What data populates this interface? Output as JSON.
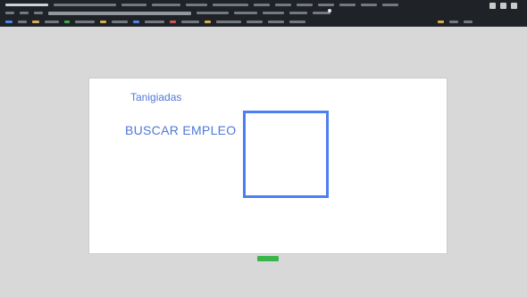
{
  "browser": {
    "window_controls": [
      "minimize",
      "maximize",
      "close"
    ]
  },
  "page": {
    "caption": "",
    "brand": "Tanigiadas",
    "headline": "BUSCAR EMPLEO",
    "side_links": [
      "",
      "",
      ""
    ],
    "cta_label": ""
  },
  "colors": {
    "page_bg": "#d8d8d8",
    "browser_chrome": "#1f2227",
    "canvas": "#ffffff",
    "brand_blue": "#4f78d8",
    "frame_blue": "#4c7ff0",
    "cta_green": "#39b54a"
  }
}
